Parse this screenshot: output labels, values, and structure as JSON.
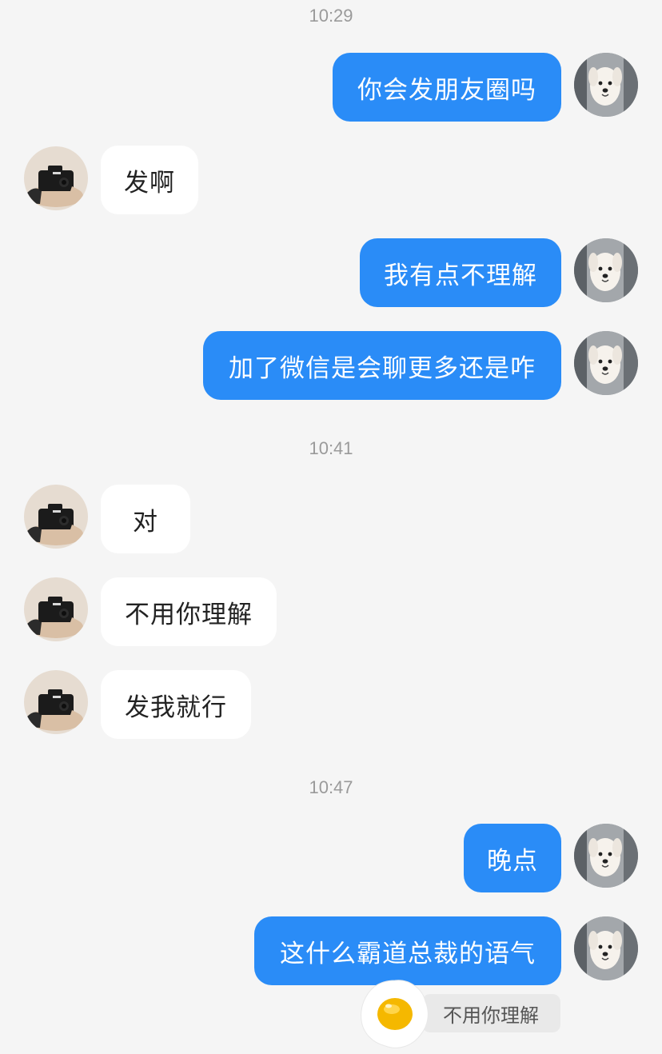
{
  "timestamps": [
    "10:29",
    "10:41",
    "10:47"
  ],
  "messages": [
    {
      "side": "out",
      "text": "你会发朋友圈吗"
    },
    {
      "side": "in",
      "text": "发啊"
    },
    {
      "side": "out",
      "text": "我有点不理解"
    },
    {
      "side": "out",
      "text": "加了微信是会聊更多还是咋"
    },
    {
      "side": "in",
      "text": "对"
    },
    {
      "side": "in",
      "text": "不用你理解"
    },
    {
      "side": "in",
      "text": "发我就行"
    },
    {
      "side": "out",
      "text": "晚点"
    },
    {
      "side": "out",
      "text": "这什么霸道总裁的语气"
    }
  ],
  "quote": {
    "text": "不用你理解"
  },
  "avatars": {
    "self": {
      "icon": "dog-avatar-icon"
    },
    "other": {
      "icon": "camera-avatar-icon"
    }
  },
  "colors": {
    "background": "#f5f5f5",
    "outgoing_bubble": "#2a8cf7",
    "incoming_bubble": "#ffffff",
    "timestamp_text": "#9a9a9a"
  }
}
